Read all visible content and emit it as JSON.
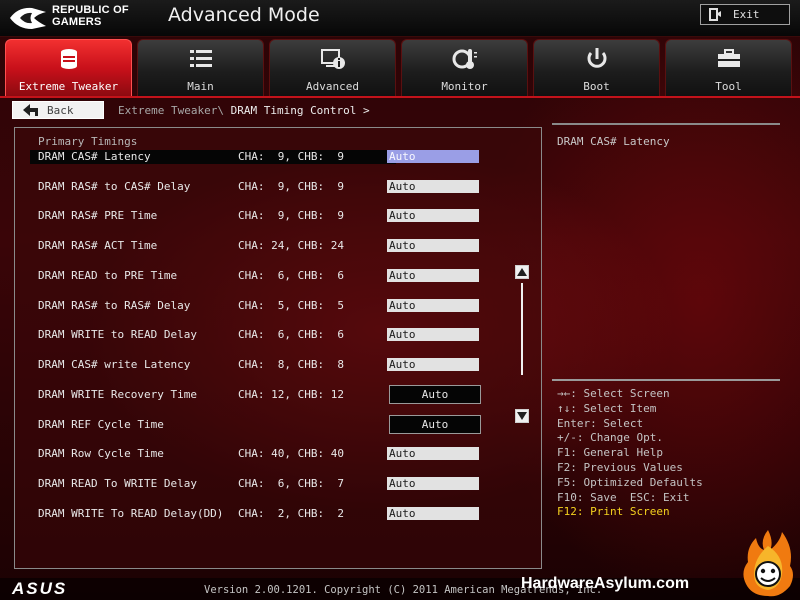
{
  "header": {
    "brand_line1": "REPUBLIC OF",
    "brand_line2": "GAMERS",
    "mode_title": "Advanced Mode",
    "exit_label": "Exit"
  },
  "tabs": [
    {
      "label": "Extreme Tweaker",
      "icon": "extreme-tweaker-icon",
      "active": true
    },
    {
      "label": "Main",
      "icon": "list-icon",
      "active": false
    },
    {
      "label": "Advanced",
      "icon": "advanced-info-icon",
      "active": false
    },
    {
      "label": "Monitor",
      "icon": "thermometer-fan-icon",
      "active": false
    },
    {
      "label": "Boot",
      "icon": "power-icon",
      "active": false
    },
    {
      "label": "Tool",
      "icon": "toolbox-icon",
      "active": false
    }
  ],
  "nav": {
    "back_label": "Back",
    "breadcrumb_parent": "Extreme Tweaker\\",
    "breadcrumb_current": "DRAM Timing Control >"
  },
  "main": {
    "section_title": "Primary Timings",
    "rows": [
      {
        "name": "DRAM CAS# Latency",
        "cha": "CHA:  9, CHB:  9",
        "value": "Auto",
        "style": "field",
        "selected": true
      },
      {
        "name": "DRAM RAS# to CAS# Delay",
        "cha": "CHA:  9, CHB:  9",
        "value": "Auto",
        "style": "field",
        "selected": false
      },
      {
        "name": "DRAM RAS# PRE Time",
        "cha": "CHA:  9, CHB:  9",
        "value": "Auto",
        "style": "field",
        "selected": false
      },
      {
        "name": "DRAM RAS# ACT Time",
        "cha": "CHA: 24, CHB: 24",
        "value": "Auto",
        "style": "field",
        "selected": false
      },
      {
        "name": "DRAM READ to PRE Time",
        "cha": "CHA:  6, CHB:  6",
        "value": "Auto",
        "style": "field",
        "selected": false
      },
      {
        "name": "DRAM RAS# to RAS# Delay",
        "cha": "CHA:  5, CHB:  5",
        "value": "Auto",
        "style": "field",
        "selected": false
      },
      {
        "name": "DRAM WRITE to READ Delay",
        "cha": "CHA:  6, CHB:  6",
        "value": "Auto",
        "style": "field",
        "selected": false
      },
      {
        "name": "DRAM CAS# write Latency",
        "cha": "CHA:  8, CHB:  8",
        "value": "Auto",
        "style": "field",
        "selected": false
      },
      {
        "name": "DRAM WRITE Recovery Time",
        "cha": "CHA: 12, CHB: 12",
        "value": "Auto",
        "style": "button",
        "selected": false
      },
      {
        "name": "DRAM REF Cycle Time",
        "cha": "",
        "value": "Auto",
        "style": "button",
        "selected": false
      },
      {
        "name": "DRAM Row Cycle Time",
        "cha": "CHA: 40, CHB: 40",
        "value": "Auto",
        "style": "field",
        "selected": false
      },
      {
        "name": "DRAM READ To WRITE Delay",
        "cha": "CHA:  6, CHB:  7",
        "value": "Auto",
        "style": "field",
        "selected": false
      },
      {
        "name": "DRAM WRITE To READ Delay(DD)",
        "cha": "CHA:  2, CHB:  2",
        "value": "Auto",
        "style": "field",
        "selected": false
      }
    ]
  },
  "help": {
    "description": "DRAM CAS# Latency",
    "keys": [
      {
        "text": "→←: Select Screen",
        "highlight": false
      },
      {
        "text": "↑↓: Select Item",
        "highlight": false
      },
      {
        "text": "Enter: Select",
        "highlight": false
      },
      {
        "text": "+/-: Change Opt.",
        "highlight": false
      },
      {
        "text": "F1: General Help",
        "highlight": false
      },
      {
        "text": "F2: Previous Values",
        "highlight": false
      },
      {
        "text": "F5: Optimized Defaults",
        "highlight": false
      },
      {
        "text": "F10: Save  ESC: Exit",
        "highlight": false
      },
      {
        "text": "F12: Print Screen",
        "highlight": true
      }
    ]
  },
  "footer": {
    "asus_logo": "ASUS",
    "version": "Version 2.00.1201. Copyright (C) 2011 American Megatrends, Inc.",
    "watermark": "HardwareAsylum.com"
  },
  "colors": {
    "accent_red": "#c8101a",
    "highlight_yellow": "#f4d21e",
    "selected_field": "#9a9ee6"
  }
}
